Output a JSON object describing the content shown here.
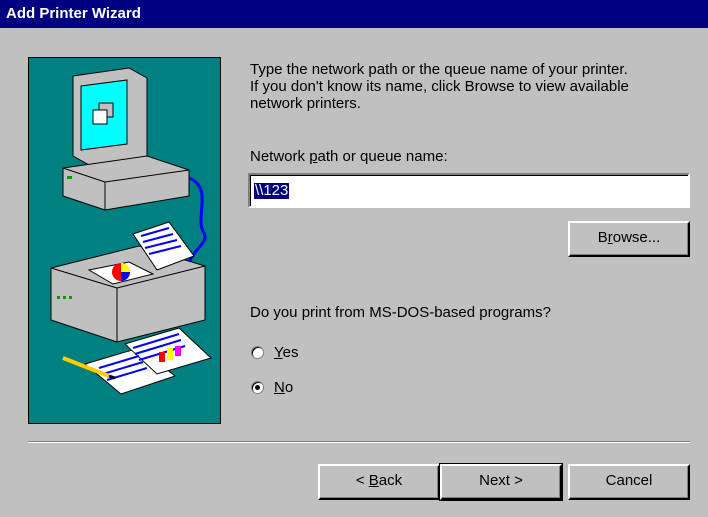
{
  "window": {
    "title": "Add Printer Wizard"
  },
  "instructions": {
    "line1": "Type the network path or the queue name of your printer.",
    "line2": "If you don't know its name, click Browse to view available",
    "line3": "network printers."
  },
  "path_field": {
    "label_pre": "Network ",
    "label_accel": "p",
    "label_post": "ath or queue name:",
    "value": "\\\\123"
  },
  "browse_button": {
    "label_pre": "B",
    "label_accel": "r",
    "label_post": "owse..."
  },
  "msdos": {
    "question": "Do you print from MS-DOS-based programs?",
    "options": [
      {
        "accel": "Y",
        "rest": "es",
        "checked": false
      },
      {
        "accel": "N",
        "rest": "o",
        "checked": true
      }
    ]
  },
  "buttons": {
    "back": {
      "pre": "< ",
      "accel": "B",
      "post": "ack"
    },
    "next": "Next >",
    "cancel": "Cancel"
  },
  "colors": {
    "title_bg": "#000080",
    "face": "#c0c0c0",
    "panel": "#008080"
  }
}
